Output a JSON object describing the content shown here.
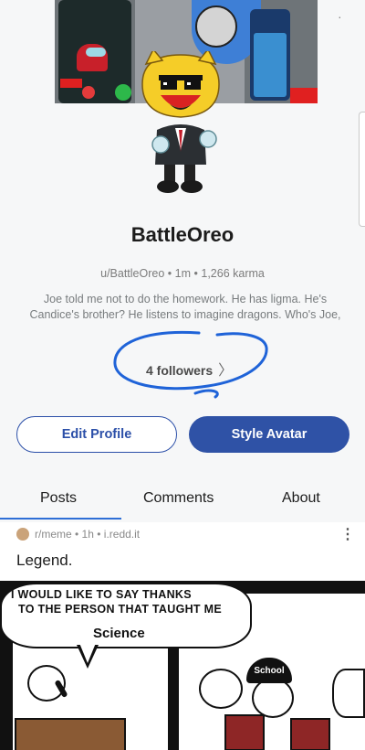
{
  "profile": {
    "username": "BattleOreo",
    "handle": "u/BattleOreo",
    "age": "1m",
    "karma": "1,266 karma",
    "bio": "Joe told me not to do the homework. He has ligma. He's Candice's brother? He listens to imagine dragons. Who's Joe, what's ligma, who's Candice what are imagine dragons? Bo...",
    "followers": "4 followers"
  },
  "buttons": {
    "edit_profile": "Edit Profile",
    "style_avatar": "Style Avatar"
  },
  "tabs": {
    "posts": "Posts",
    "comments": "Comments",
    "about": "About",
    "active": "Posts"
  },
  "post": {
    "subreddit": "r/meme",
    "age": "1h",
    "domain": "i.redd.it",
    "title": "Legend.",
    "comic": {
      "line1": "I WOULD LIKE TO SAY THANKS",
      "line2": "TO THE PERSON THAT TAUGHT ME",
      "line3": "Science",
      "hat_text": "School"
    }
  },
  "icons": {
    "followers_chevron": "chevron-right-icon",
    "post_menu": "more-vertical-icon",
    "subreddit": "subreddit-icon"
  },
  "colors": {
    "accent_blue": "#2f52a6",
    "tab_underline": "#2f6fd6",
    "scribble_blue": "#1f63d8"
  }
}
